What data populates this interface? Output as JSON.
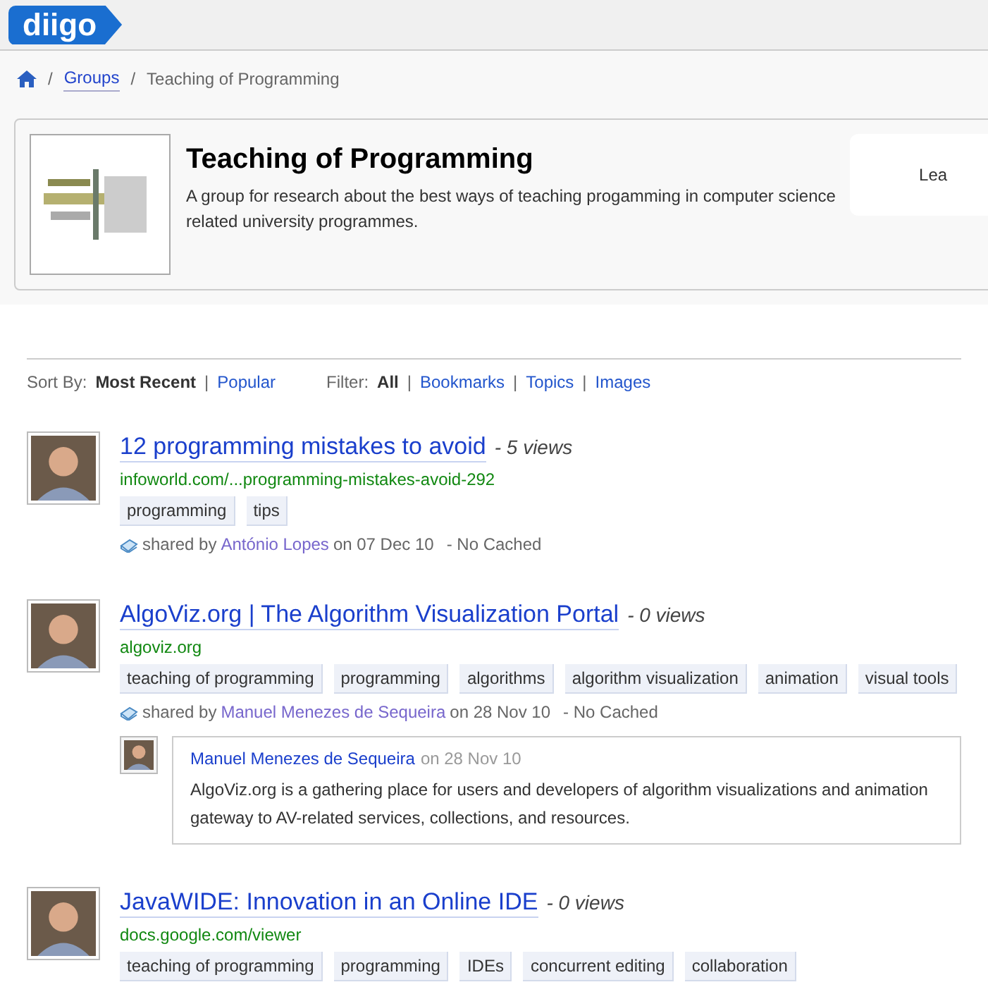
{
  "logo": {
    "text": "diigo"
  },
  "breadcrumb": {
    "separator": "/",
    "items": [
      "Groups",
      "Teaching of Programming"
    ]
  },
  "group": {
    "title": "Teaching of Programming",
    "description": "A group for research about the best ways of teaching progamming in computer science related university programmes.",
    "side_button": "Lea"
  },
  "option_separator": "|",
  "sort": {
    "label": "Sort By:",
    "options": [
      {
        "label": "Most Recent",
        "selected": true
      },
      {
        "label": "Popular",
        "selected": false
      }
    ]
  },
  "filter": {
    "label": "Filter:",
    "options": [
      {
        "label": "All",
        "selected": true
      },
      {
        "label": "Bookmarks",
        "selected": false
      },
      {
        "label": "Topics",
        "selected": false
      },
      {
        "label": "Images",
        "selected": false
      }
    ]
  },
  "items": [
    {
      "title": "12 programming mistakes to avoid",
      "views": "- 5 views",
      "url": "infoworld.com/...programming-mistakes-avoid-292",
      "tags": [
        "programming",
        "tips"
      ],
      "shared_prefix": "shared by",
      "author": "António Lopes",
      "date": "on 07 Dec 10",
      "cache": "- No Cached"
    },
    {
      "title": "AlgoViz.org | The Algorithm Visualization Portal",
      "views": "- 0 views",
      "url": "algoviz.org",
      "tags": [
        "teaching of programming",
        "programming",
        "algorithms",
        "algorithm visualization",
        "animation",
        "visual tools"
      ],
      "shared_prefix": "shared by",
      "author": "Manuel Menezes de Sequeira",
      "date": "on 28 Nov 10",
      "cache": "- No Cached",
      "comment": {
        "author": "Manuel Menezes de Sequeira",
        "date": "on 28 Nov 10",
        "text": "AlgoViz.org is a gathering place for users and developers of algorithm visualizations and animation gateway to AV-related services, collections, and resources."
      }
    },
    {
      "title": "JavaWIDE: Innovation in an Online IDE",
      "views": "- 0 views",
      "url": "docs.google.com/viewer",
      "tags": [
        "teaching of programming",
        "programming",
        "IDEs",
        "concurrent editing",
        "collaboration"
      ]
    }
  ]
}
